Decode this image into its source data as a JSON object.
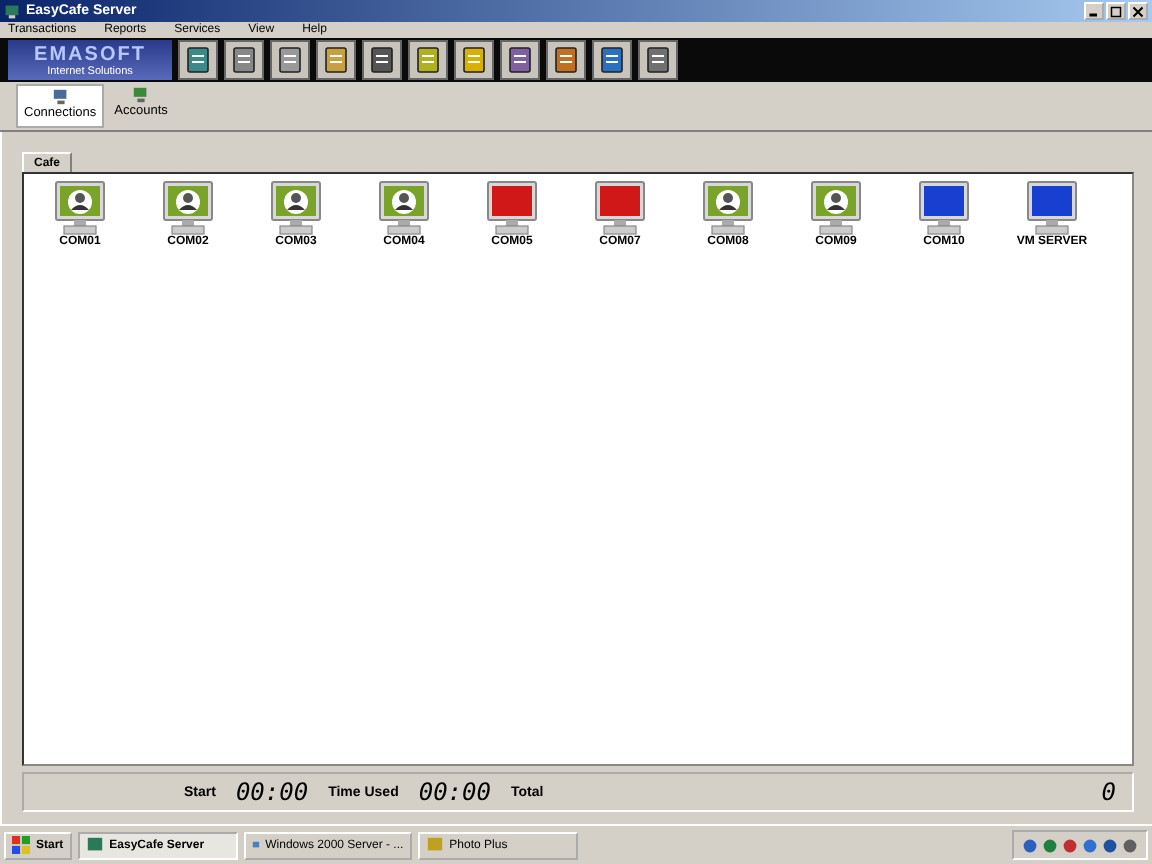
{
  "window": {
    "title": "EasyCafe Server"
  },
  "menu": [
    "Transactions",
    "Reports",
    "Services",
    "View",
    "Help"
  ],
  "logo": {
    "name": "EMASOFT",
    "tagline": "Internet Solutions"
  },
  "tabs": [
    {
      "label": "Connections",
      "selected": true
    },
    {
      "label": "Accounts",
      "selected": false
    }
  ],
  "group_tab": {
    "label": "Cafe",
    "selected": true
  },
  "computers": [
    {
      "name": "COM01",
      "kind": "user"
    },
    {
      "name": "COM02",
      "kind": "user"
    },
    {
      "name": "COM03",
      "kind": "user"
    },
    {
      "name": "COM04",
      "kind": "user"
    },
    {
      "name": "COM05",
      "kind": "red"
    },
    {
      "name": "COM07",
      "kind": "red"
    },
    {
      "name": "COM08",
      "kind": "user"
    },
    {
      "name": "COM09",
      "kind": "user"
    },
    {
      "name": "COM10",
      "kind": "blue"
    },
    {
      "name": "VM SERVER",
      "kind": "blue"
    }
  ],
  "status_bar": {
    "start_label": "Start",
    "start_time": "00:00",
    "used_label": "Time Used",
    "used_time": "00:00",
    "total_label": "Total",
    "total_value": "0"
  },
  "taskbar": {
    "start": "Start",
    "tasks": [
      {
        "label": "EasyCafe Server",
        "selected": true
      },
      {
        "label": "Windows 2000 Server - ...",
        "selected": false
      },
      {
        "label": "Photo Plus",
        "selected": false
      }
    ]
  }
}
